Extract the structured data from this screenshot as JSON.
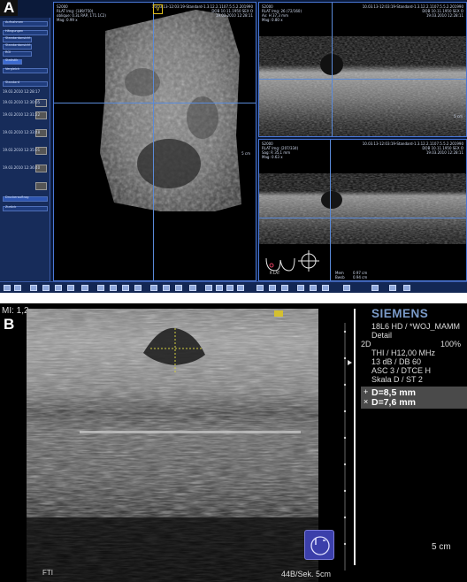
{
  "panel_a": {
    "label": "A",
    "sidebar": {
      "items": [
        "Aufnahmen",
        "Hängungen",
        "Standardansicht",
        "Standardansicht",
        "ROI",
        "Statistik",
        "Vergleich",
        "Standard",
        "Druckerauftrag",
        "Zurück"
      ],
      "series": [
        "19.03.2010 12:28:17",
        "19.03.2010 12:30:05",
        "19.03.2010 12:31:22",
        "19.03.2010 12:33:48",
        "19.03.2010 12:35:01",
        "19.03.2010 12:36:40"
      ]
    },
    "view_3d": {
      "info_left": [
        "S2000",
        "RLAT Img: (189/750)",
        "oblique: 0.3L RAP, 171.1C2)",
        "Mag: 0.99 x"
      ],
      "info_right": [
        "10.03.13-12:03:19-Standard-1.3.12.2.1107.5.5.2.201990",
        "DOB 10.11.1950 SEX O",
        "19.03.2010 12:28:11"
      ],
      "orientation_marker": "V",
      "scale": "5 cm"
    },
    "view_top": {
      "info_left": [
        "S2000",
        "RLAT Img: 26 (72/160)",
        "Ax: H   37,3 mm",
        "Mag: 0.80 x"
      ],
      "info_right": [
        "10.03.13-12:03:19-Standard-1.3.12.2.1107.5.5.2.201990",
        "DOB 10.11.1950 SEX O",
        "19.03.2010 12:28:11"
      ],
      "scale": "5 cm"
    },
    "view_bottom": {
      "info_left": [
        "S2000",
        "RLAT Img: (207/334)",
        "Sag: R   35,1 mm",
        "Mag: 0.63 x"
      ],
      "info_right": [
        "10.03.13-12:03:19-Standard-1.3.12.2.1107.5.5.2.201990",
        "DOB 10.11.1950 SEX O",
        "19.03.2010 12:28:11"
      ],
      "breast_label": "R LAT",
      "bottom_text": [
        "Mem",
        "Bwsb",
        "0.97 cm",
        "0.94 cm"
      ]
    }
  },
  "panel_b": {
    "label": "B",
    "mi": "MI: 1,2",
    "brand": "SIEMENS",
    "probe": "18L6 HD / *WOJ_MAMM",
    "preset": "Detail",
    "mode": "2D",
    "percent": "100%",
    "lines": [
      "THI / H12,00 MHz",
      "13 dB / DB 60",
      "ASC 3 / DTCE H",
      "Skala D / ST 2"
    ],
    "measurements": [
      "D=8,5 mm",
      "D=7,6 mm"
    ],
    "measure_marks": [
      "+",
      "×"
    ],
    "scale": "5 cm",
    "fti": "FTI",
    "footer": "44B/Sek. 5cm",
    "accent": "#3b3faa"
  }
}
